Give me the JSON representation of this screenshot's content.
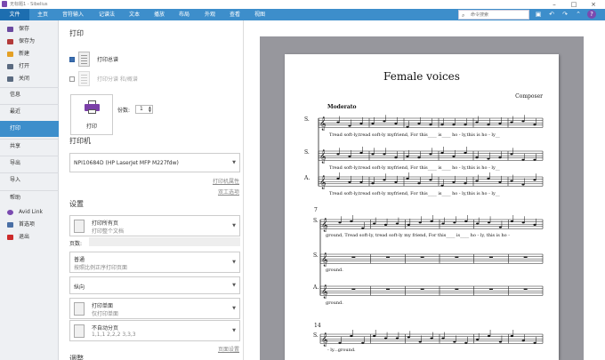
{
  "app": {
    "title": "无标题1 - Sibelius"
  },
  "menubar": {
    "items": [
      "文件",
      "主页",
      "音符输入",
      "记谱法",
      "文本",
      "播放",
      "布局",
      "外观",
      "查看",
      "视图"
    ],
    "search_placeholder": "命令搜索"
  },
  "sidebar": {
    "items": [
      {
        "label": "保存",
        "icon": "save-icon",
        "color": "#6b4aa0"
      },
      {
        "label": "保存为",
        "icon": "save-as-icon",
        "color": "#b33a3a"
      },
      {
        "label": "新建",
        "icon": "new-icon",
        "color": "#e4a025"
      },
      {
        "label": "打开",
        "icon": "open-icon",
        "color": "#5a6a80"
      },
      {
        "label": "关闭",
        "icon": "close-file-icon",
        "color": "#5a6a80"
      },
      {
        "label": "信息"
      },
      {
        "label": "最近"
      },
      {
        "label": "打印"
      },
      {
        "label": "共享"
      },
      {
        "label": "导出"
      },
      {
        "label": "导入"
      },
      {
        "label": "帮助"
      },
      {
        "label": "Avid Link",
        "icon": "avid-link-icon",
        "color": "#7a4ab0"
      },
      {
        "label": "首选项",
        "icon": "preferences-icon",
        "color": "#4a6fa5"
      },
      {
        "label": "退出",
        "icon": "exit-icon",
        "color": "#cc2b2b"
      }
    ]
  },
  "print": {
    "heading": "打印",
    "option_full_score": "打印总谱",
    "option_parts": "打印分谱 和/概谱",
    "print_button": "打印",
    "copies_label": "份数:",
    "copies_value": "1",
    "printer_heading": "打印机",
    "printer_name": "NPI10684D (HP LaserJet MFP M227fdw)",
    "printer_props_link": "打印机属性",
    "double_sided_link": "双工选项",
    "settings_heading": "设置",
    "all_pages_main": "打印所有页",
    "all_pages_sub": "打印整个文档",
    "pages_label": "页数:",
    "normal_main": "普通",
    "normal_sub": "按照比例正序打印页面",
    "orientation": "纵向",
    "single_main": "打印单面",
    "single_sub": "仅打印单面",
    "collate_main": "不自动分页",
    "collate_sub": "1,1,1 2,2,2 3,3,3",
    "page_setup_link": "页面设置",
    "adjust_heading": "调整"
  },
  "score": {
    "title": "Female voices",
    "composer": "Composer",
    "tempo": "Moderato",
    "staff_labels": [
      "S.",
      "S.",
      "A.",
      "S.",
      "S.",
      "A.",
      "S."
    ],
    "system2_number": "7",
    "system3_number": "14",
    "lyrics": {
      "l1": "Tread  soft-ly,tread  soft-ly myfriend,  For   this____ is____ ho - ly,this is   ho  -   ly__",
      "l2": "Tread  soft-ly,tread  soft-ly myfriend,  For   this____ is____ ho - ly,this is   ho  -   ly__",
      "l3": "Tread  soft-ly,tread  soft-ly myfriend,  For   this____ is____ ho - ly,this is   ho  -   ly__",
      "l4": "ground,  Tread soft-ly, tread soft-ly  my friend,  For  this____  is____  ho - ly,  this is  ho -",
      "l5": "ground.",
      "l6": "ground.",
      "l7": "- ly...ground."
    }
  }
}
